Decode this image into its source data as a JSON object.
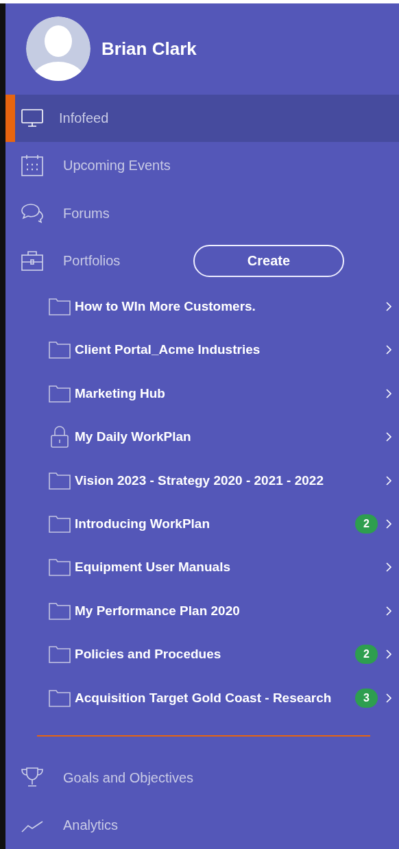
{
  "user": {
    "name": "Brian Clark"
  },
  "nav": [
    {
      "label": "Infofeed",
      "selected": true
    },
    {
      "label": "Upcoming Events",
      "selected": false
    },
    {
      "label": "Forums",
      "selected": false
    },
    {
      "label": "Portfolios",
      "selected": false,
      "action": "Create"
    }
  ],
  "portfolios": [
    {
      "title": "How to WIn More Customers.",
      "kind": "folder"
    },
    {
      "title": "Client Portal_Acme Industries",
      "kind": "folder"
    },
    {
      "title": "Marketing Hub",
      "kind": "folder"
    },
    {
      "title": "My Daily WorkPlan",
      "kind": "lock"
    },
    {
      "title": "Vision 2023 - Strategy 2020 - 2021 - 2022",
      "kind": "folder"
    },
    {
      "title": "Introducing WorkPlan",
      "kind": "folder",
      "badge": "2"
    },
    {
      "title": "Equipment User Manuals",
      "kind": "folder"
    },
    {
      "title": "My Performance Plan 2020",
      "kind": "folder"
    },
    {
      "title": "Policies and Procedues",
      "kind": "folder",
      "badge": "2"
    },
    {
      "title": "Acquisition Target Gold Coast - Research",
      "kind": "folder",
      "badge": "3"
    }
  ],
  "bottom_nav": [
    {
      "label": "Goals and Objectives",
      "selected": false
    },
    {
      "label": "Analytics",
      "selected": false
    }
  ]
}
